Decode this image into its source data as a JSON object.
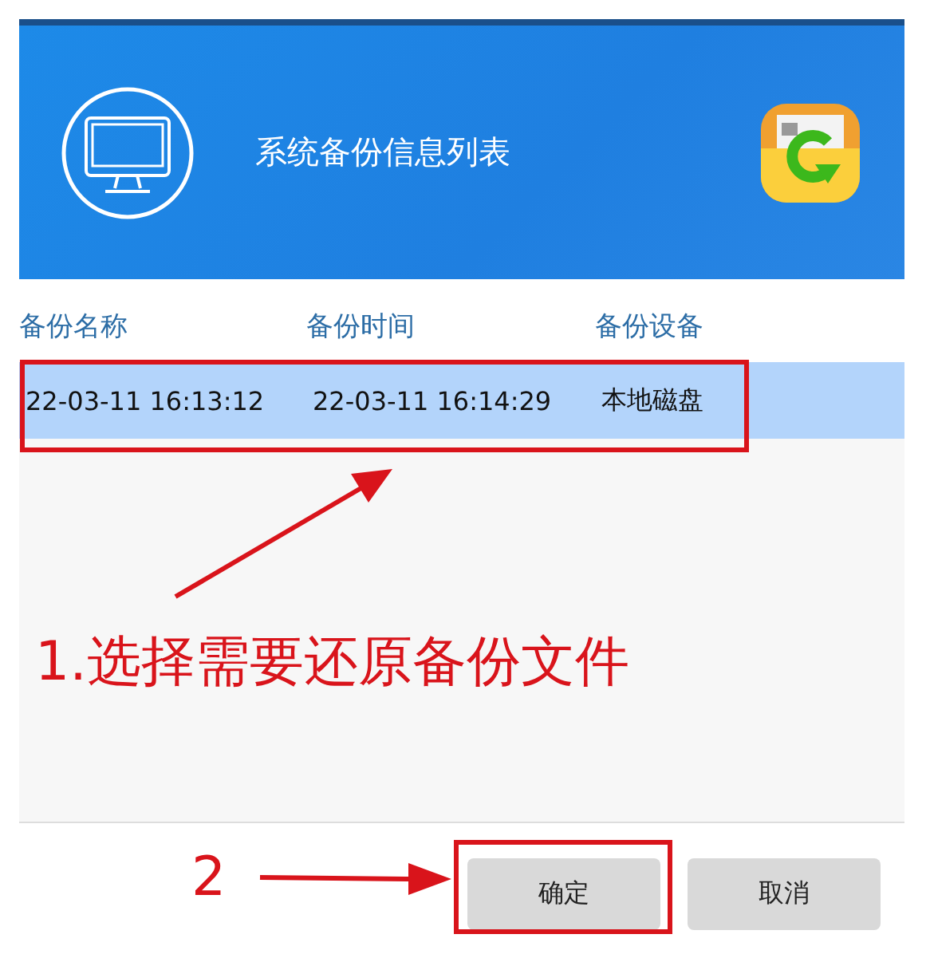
{
  "header": {
    "title": "系统备份信息列表"
  },
  "table": {
    "columns": [
      "备份名称",
      "备份时间",
      "备份设备"
    ],
    "rows": [
      {
        "cells": [
          "22-03-11 16:13:12",
          "22-03-11 16:14:29",
          "本地磁盘"
        ],
        "selected": true
      }
    ]
  },
  "buttons": [
    "确定",
    "取消"
  ],
  "annotations": [
    {
      "text": "1.选择需要还原备份文件"
    },
    {
      "text": "2"
    }
  ]
}
